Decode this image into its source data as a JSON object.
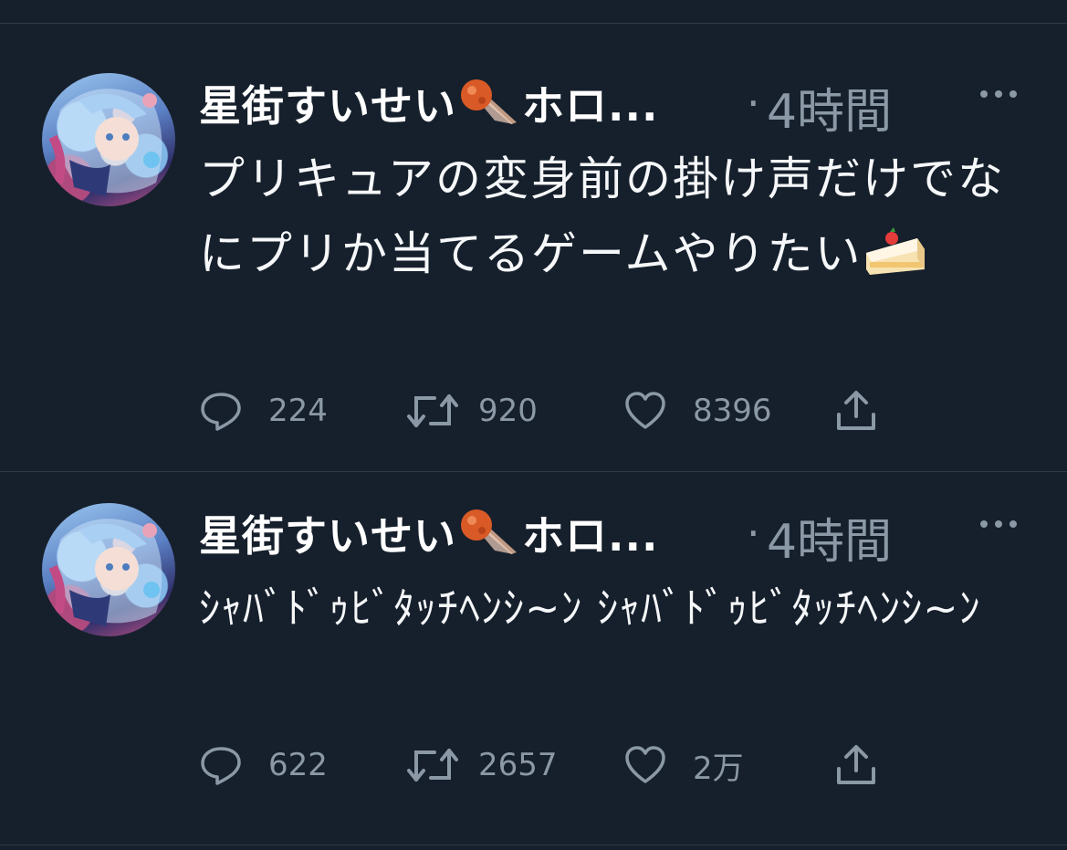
{
  "colors": {
    "background": "#16202c",
    "text": "#ffffff",
    "secondary": "#8b98a5",
    "divider": "#2f3a47"
  },
  "tweets": [
    {
      "author_name": "星街すいせい",
      "author_suffix": "ホロ...",
      "name_badge_icon": "comet-emoji",
      "separator": "·",
      "time": "4時間",
      "text": "プリキュアの変身前の掛け声だけでなにプリか当てるゲームやりたい",
      "text_emoji": "shortcake-emoji",
      "replies": "224",
      "retweets": "920",
      "likes": "8396"
    },
    {
      "author_name": "星街すいせい",
      "author_suffix": "ホロ...",
      "name_badge_icon": "comet-emoji",
      "separator": "·",
      "time": "4時間",
      "text": "ｼｬﾊﾞﾄﾞｩﾋﾞﾀｯﾁﾍﾝｼ~ﾝ ｼｬﾊﾞﾄﾞｩﾋﾞﾀｯﾁﾍﾝｼ~ﾝ",
      "replies": "622",
      "retweets": "2657",
      "likes": "2万"
    }
  ],
  "icons": {
    "reply": "reply-icon",
    "retweet": "retweet-icon",
    "like": "heart-icon",
    "share": "share-icon",
    "more": "more-icon"
  }
}
